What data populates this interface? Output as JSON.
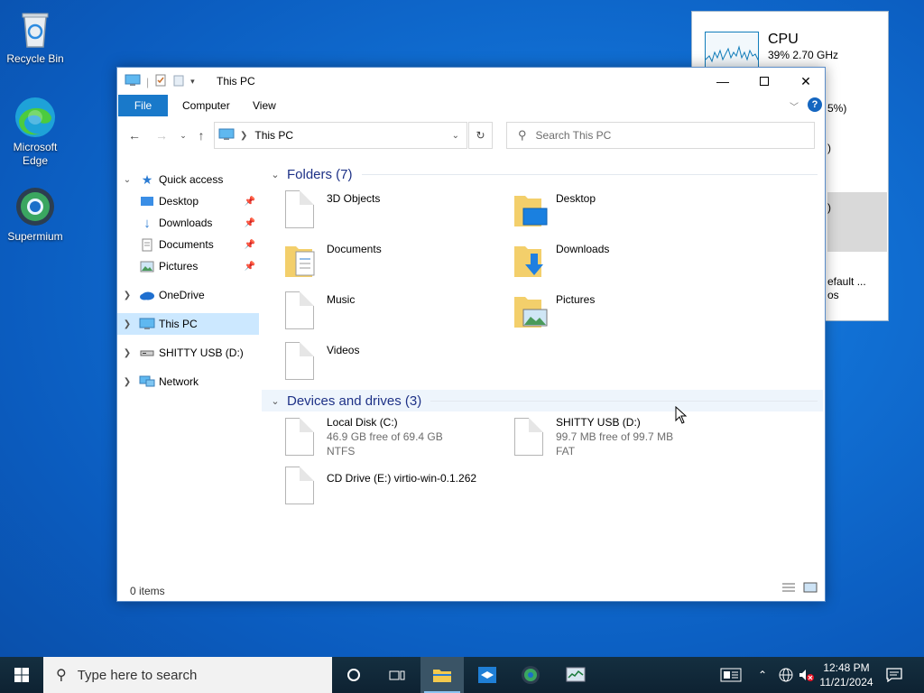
{
  "desktop": {
    "icons": [
      {
        "label": "Recycle Bin"
      },
      {
        "label": "Microsoft Edge"
      },
      {
        "label": "Supermium"
      }
    ]
  },
  "taskmgr": {
    "cpu_label": "CPU",
    "cpu_sub": "39%  2.70 GHz",
    "frag_1": "5%)",
    "frag_2": ")",
    "frag_3": ")",
    "frag_4": "efault ...",
    "frag_5": "os"
  },
  "explorer": {
    "title": "This PC",
    "tabs": {
      "file": "File",
      "computer": "Computer",
      "view": "View"
    },
    "address": "This PC",
    "search_placeholder": "Search This PC",
    "nav": {
      "quick_access": "Quick access",
      "desktop": "Desktop",
      "downloads": "Downloads",
      "documents": "Documents",
      "pictures": "Pictures",
      "onedrive": "OneDrive",
      "this_pc": "This PC",
      "usb": "SHITTY USB (D:)",
      "network": "Network"
    },
    "folders_header": "Folders (7)",
    "folders": [
      {
        "name": "3D Objects"
      },
      {
        "name": "Desktop"
      },
      {
        "name": "Documents"
      },
      {
        "name": "Downloads"
      },
      {
        "name": "Music"
      },
      {
        "name": "Pictures"
      },
      {
        "name": "Videos"
      }
    ],
    "drives_header": "Devices and drives (3)",
    "drives": [
      {
        "name": "Local Disk (C:)",
        "free": "46.9 GB free of 69.4 GB",
        "fs": "NTFS"
      },
      {
        "name": "SHITTY USB (D:)",
        "free": "99.7 MB free of 99.7 MB",
        "fs": "FAT"
      },
      {
        "name": "CD Drive (E:) virtio-win-0.1.262"
      }
    ],
    "status": "0 items"
  },
  "taskbar": {
    "search_placeholder": "Type here to search",
    "time": "12:48 PM",
    "date": "11/21/2024"
  }
}
